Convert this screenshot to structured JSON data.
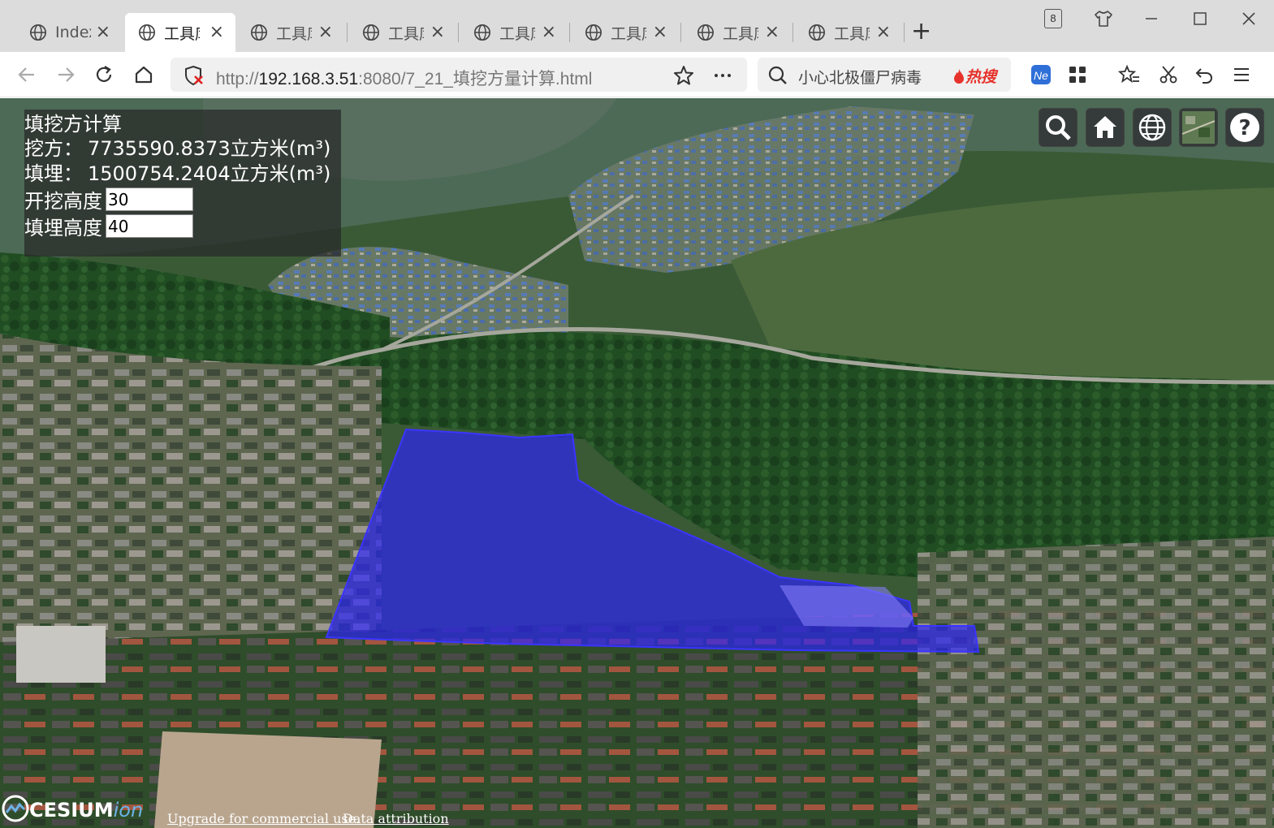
{
  "browser": {
    "tabs": [
      {
        "title": "Index",
        "active": false
      },
      {
        "title": "工具库",
        "active": true
      },
      {
        "title": "工具库",
        "active": false
      },
      {
        "title": "工具库",
        "active": false
      },
      {
        "title": "工具库",
        "active": false
      },
      {
        "title": "工具库",
        "active": false
      },
      {
        "title": "工具库",
        "active": false
      },
      {
        "title": "工具库",
        "active": false
      }
    ],
    "tab_count": "8",
    "new_tab": "+",
    "url_prefix": "http://",
    "url_host": "192.168.3.51",
    "url_rest": ":8080/7_21_填挖方量计算.html",
    "search_text": "小心北极僵尸病毒",
    "hot_label": "热搜"
  },
  "panel": {
    "title": "填挖方计算",
    "cut_label": "挖方：",
    "cut_value": "7735590.8373立方米(m³)",
    "fill_label": "填埋：",
    "fill_value": "1500754.2404立方米(m³)",
    "dig_height_label": "开挖高度",
    "dig_height_value": "30",
    "fill_height_label": "填埋高度",
    "fill_height_value": "40"
  },
  "credits": {
    "logo_main": "CESIUM",
    "logo_ion": "ion",
    "upgrade_link": "Upgrade for commercial use.",
    "attribution_link": "Data attribution"
  },
  "colors": {
    "polygon_fill": "#2a22ff",
    "forest": "#1f4a22",
    "water": "#3c5a4a"
  },
  "icons": [
    "globe-icon",
    "close-icon",
    "back-icon",
    "forward-icon",
    "reload-icon",
    "home-icon",
    "shield-error-icon",
    "star-icon",
    "more-icon",
    "search-icon",
    "fire-icon",
    "grid-icon",
    "favorites-icon",
    "scissors-icon",
    "undo-icon",
    "menu-icon",
    "geocoder-search-icon",
    "map-home-icon",
    "scene-mode-globe-icon",
    "base-layer-picker-icon",
    "help-icon"
  ]
}
